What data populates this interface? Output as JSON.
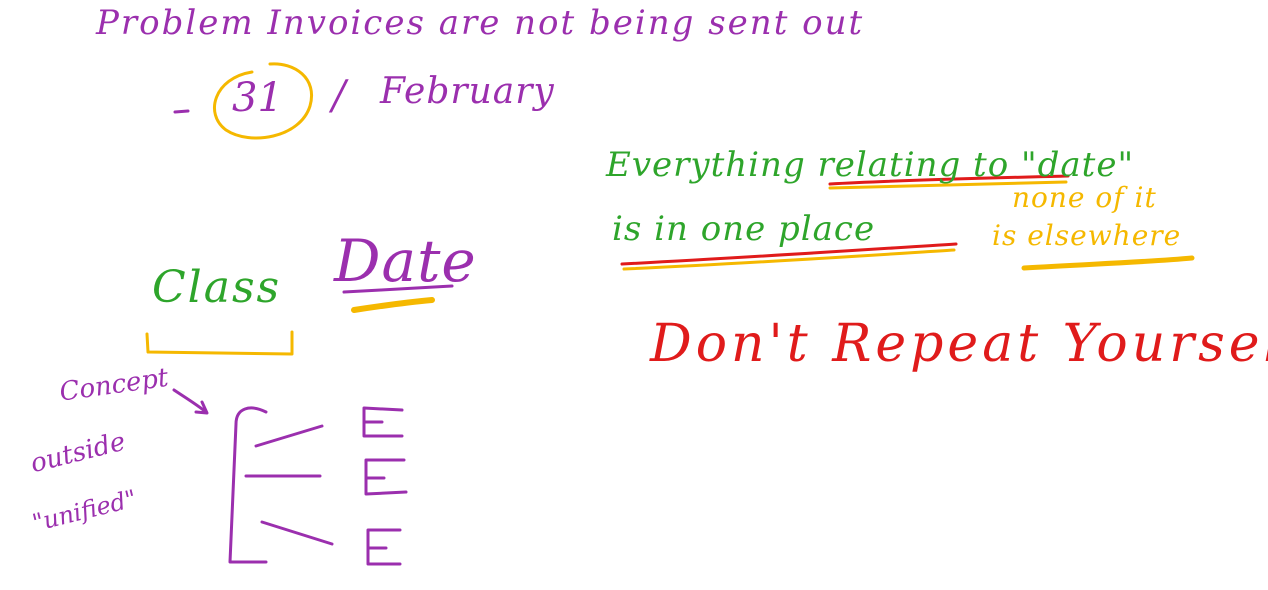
{
  "notes": {
    "problem": "Problem  Invoices  are  not being  sent out",
    "date_number": "31",
    "slash": "/",
    "month": "February",
    "everything_line": "Everything relating to \"date\"",
    "one_place_line": "is in one place",
    "none_of_it": "none of it",
    "elsewhere": "is elsewhere",
    "class_word": "Class",
    "date_word": "Date",
    "dry": "Don't Repeat Yourself",
    "concept": "Concept",
    "outside": "outside",
    "unified": "\"unified\""
  },
  "colors": {
    "purple": "#9b2fae",
    "green": "#2ea52b",
    "yellow": "#f5b800",
    "red": "#e01b1b",
    "background": "#ffffff"
  }
}
